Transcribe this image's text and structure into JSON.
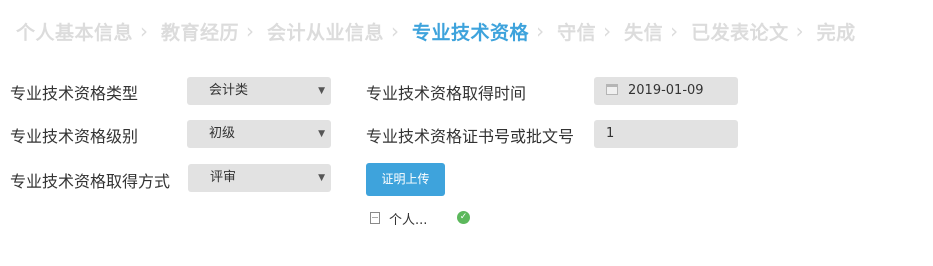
{
  "steps": [
    {
      "label": "个人基本信息",
      "active": false
    },
    {
      "label": "教育经历",
      "active": false
    },
    {
      "label": "会计从业信息",
      "active": false
    },
    {
      "label": "专业技术资格",
      "active": true
    },
    {
      "label": "守信",
      "active": false
    },
    {
      "label": "失信",
      "active": false
    },
    {
      "label": "已发表论文",
      "active": false
    },
    {
      "label": "完成",
      "active": false
    }
  ],
  "step_separator": "›",
  "form": {
    "type_label": "专业技术资格类型",
    "type_value": "会计类",
    "level_label": "专业技术资格级别",
    "level_value": "初级",
    "method_label": "专业技术资格取得方式",
    "method_value": "评审",
    "date_label": "专业技术资格取得时间",
    "date_value": "2019-01-09",
    "cert_label": "专业技术资格证书号或批文号",
    "cert_value": "1",
    "upload_label": "证明上传",
    "file_name": "个人...",
    "caret": "▼",
    "check": "✓"
  },
  "colors": {
    "accent": "#3ea3dc",
    "inactive_step": "#dcdcdc",
    "field_bg": "#e2e2e2",
    "success": "#5cb85c"
  },
  "icons": [
    "chevron-right-icon",
    "calendar-icon",
    "file-icon",
    "check-circle-icon",
    "caret-down-icon"
  ]
}
